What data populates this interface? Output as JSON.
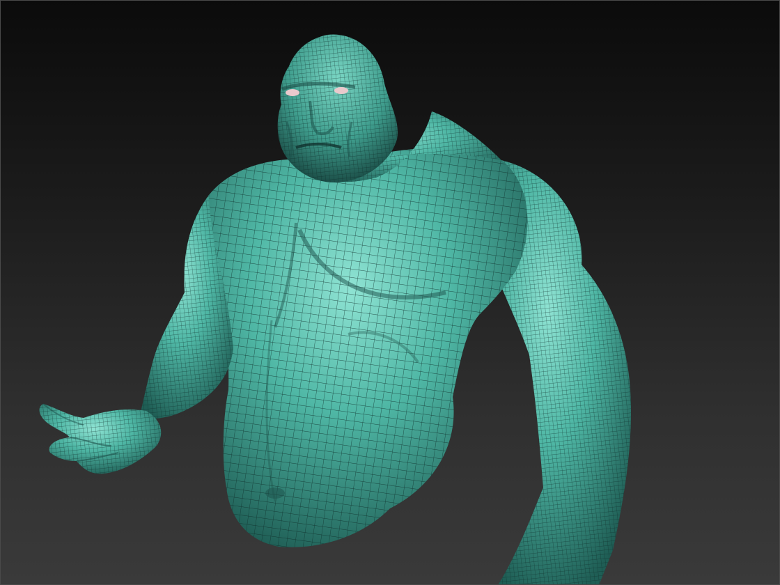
{
  "viewport": {
    "background_top": "#0b0b0b",
    "background_bottom": "#3a3a3a"
  },
  "model": {
    "subject": "sculpted-muscular-brute-bust",
    "display_mode": "polyframe-wireframe-overlay",
    "material_color": "#4fb7a5",
    "material_highlight": "#8fe3d3",
    "material_shadow": "#1f5e55",
    "wire_color": "#0d2a26",
    "eye_color": "#e9c9cc"
  }
}
